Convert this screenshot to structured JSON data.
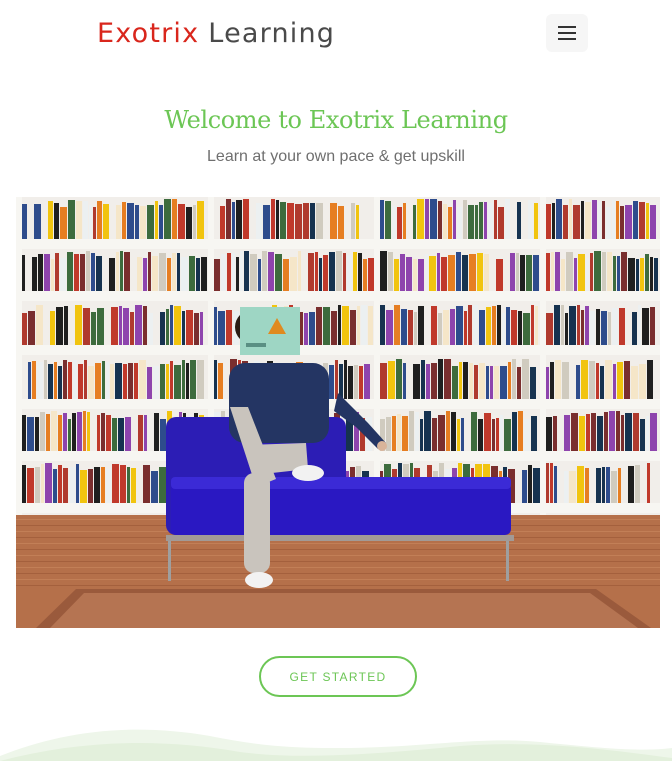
{
  "header": {
    "brand_part1": "Exotrix",
    "brand_part2": "Learning",
    "menu_icon": "hamburger-menu-icon"
  },
  "hero": {
    "title": "Welcome to Exotrix Learning",
    "subtitle": "Learn at your own pace & get upskill",
    "image_description": "Person reading on a blue chaise lounge in front of bookshelves",
    "cta_label": "GET STARTED"
  },
  "colors": {
    "brand_red": "#d9261c",
    "brand_gray": "#4a4a4a",
    "accent_green": "#6cc655",
    "subtitle_gray": "#6f6f6f",
    "wave_green": "#e8f3e2"
  }
}
